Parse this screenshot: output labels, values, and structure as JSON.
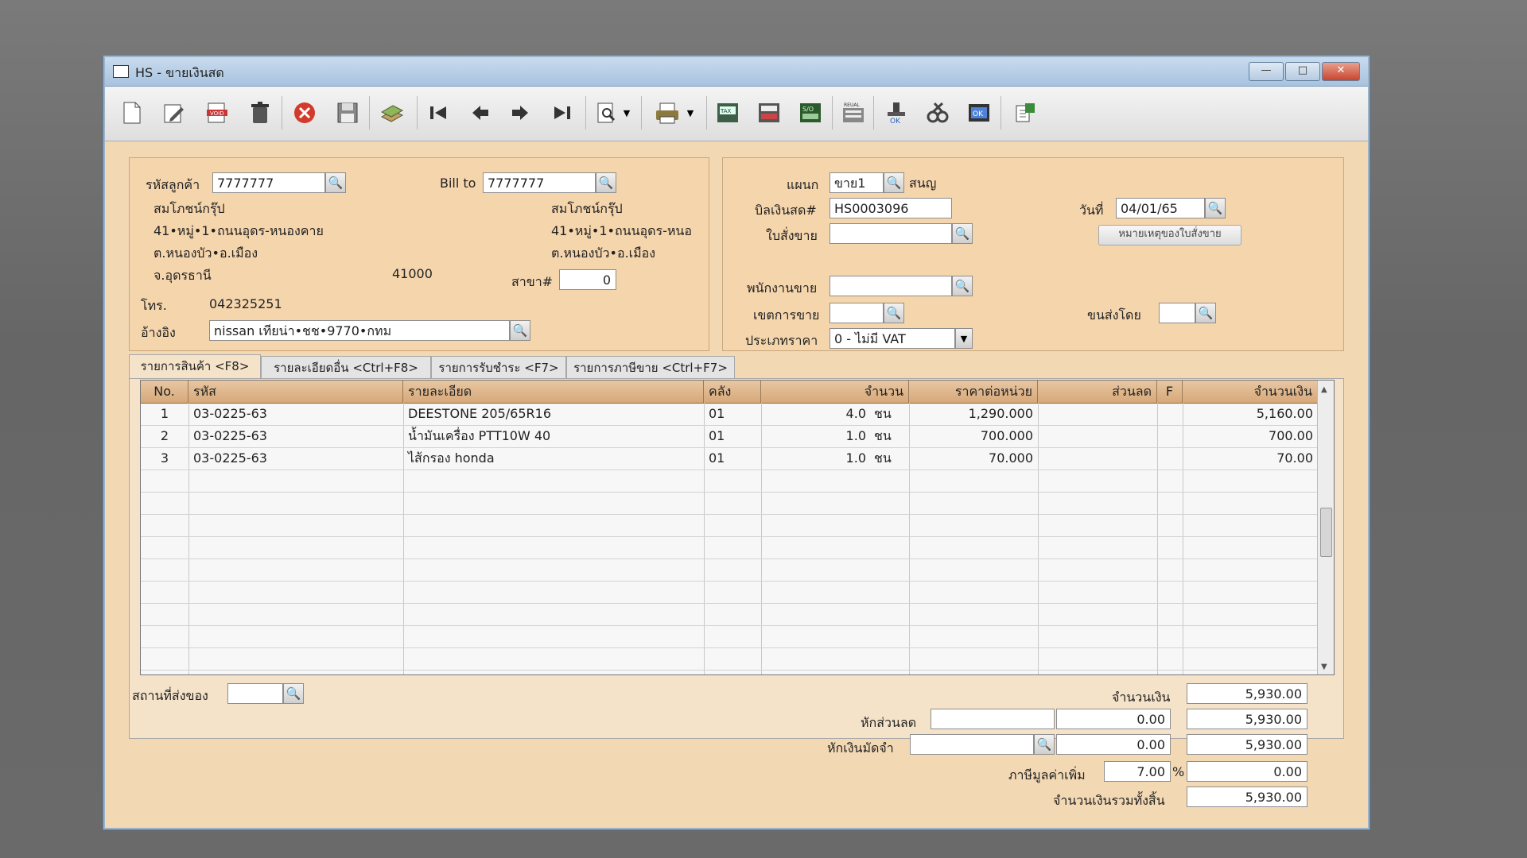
{
  "window": {
    "title": "HS - ขายเงินสด",
    "minimize": "—",
    "maximize": "□",
    "close": "✕"
  },
  "toolbar": {
    "icons": [
      "new-doc-icon",
      "edit-icon",
      "void-icon",
      "delete-icon",
      "cancel-icon",
      "save-icon",
      "stack-icon",
      "first-icon",
      "prev-icon",
      "next-icon",
      "last-icon",
      "search-doc-icon",
      "print-icon",
      "tax-invoice-icon",
      "form-icon",
      "so-icon",
      "report-icon",
      "approve-icon",
      "tools-icon",
      "ok-icon",
      "export-icon"
    ]
  },
  "customer": {
    "code_label": "รหัสลูกค้า",
    "code": "7777777",
    "billto_label": "Bill to",
    "billto": "7777777",
    "name": "สมโภชน์กรุ๊ป",
    "addr1": "41•หมู่•1•ถนนอุดร-หนองคาย",
    "addr2": "ต.หนองบัว•อ.เมือง",
    "province": "จ.อุดรธานี",
    "zip": "41000",
    "billto_name": "สมโภชน์กรุ๊ป",
    "billto_addr1": "41•หมู่•1•ถนนอุดร-หนอ",
    "billto_addr2": "ต.หนองบัว•อ.เมือง",
    "branch_label": "สาขา#",
    "branch": "0",
    "phone_label": "โทร.",
    "phone": "042325251",
    "ref_label": "อ้างอิง",
    "ref": "nissan เทียน่า•ชช•9770•กทม"
  },
  "doc": {
    "dept_label": "แผนก",
    "dept": "ขาย1",
    "dept_name": "สนญ",
    "bill_label": "บิลเงินสด#",
    "bill": "HS0003096",
    "date_label": "วันที่",
    "date": "04/01/65",
    "so_label": "ใบสั่งขาย",
    "so": "",
    "note_button": "หมายเหตุของใบสั่งขาย",
    "sales_label": "พนักงานขาย",
    "sales": "",
    "area_label": "เขตการขาย",
    "area": "",
    "ship_label": "ขนส่งโดย",
    "ship": "",
    "price_type_label": "ประเภทราคา",
    "price_type": "0 - ไม่มี VAT"
  },
  "tabs": [
    "รายการสินค้า <F8>",
    "รายละเอียดอื่น <Ctrl+F8>",
    "รายการรับชำระ <F7>",
    "รายการภาษีขาย <Ctrl+F7>"
  ],
  "grid": {
    "headers": [
      "No.",
      "รหัส",
      "รายละเอียด",
      "คลัง",
      "จำนวน",
      "ราคาต่อหน่วย",
      "ส่วนลด",
      "F",
      "จำนวนเงิน"
    ],
    "rows": [
      {
        "no": "1",
        "code": "03-0225-63",
        "desc": "DEESTONE 205/65R16",
        "wh": "01",
        "qty": "4.0",
        "unit": "ชน",
        "price": "1,290.000",
        "disc": "",
        "f": "",
        "amount": "5,160.00"
      },
      {
        "no": "2",
        "code": "03-0225-63",
        "desc": "น้ำมันเครื่อง PTT10W 40",
        "wh": "01",
        "qty": "1.0",
        "unit": "ชน",
        "price": "700.000",
        "disc": "",
        "f": "",
        "amount": "700.00"
      },
      {
        "no": "3",
        "code": "03-0225-63",
        "desc": "ไส้กรอง honda",
        "wh": "01",
        "qty": "1.0",
        "unit": "ชน",
        "price": "70.000",
        "disc": "",
        "f": "",
        "amount": "70.00"
      }
    ]
  },
  "footer": {
    "delivery_label": "สถานที่ส่งของ",
    "delivery": "",
    "total_label": "จำนวนเงิน",
    "total": "5,930.00",
    "discount_label": "หักส่วนลด",
    "discount_text": "",
    "discount_amount": "0.00",
    "after_discount": "5,930.00",
    "deposit_label": "หักเงินมัดจำ",
    "deposit_text": "",
    "deposit_amount": "0.00",
    "after_deposit": "5,930.00",
    "vat_label": "ภาษีมูลค่าเพิ่ม",
    "vat_rate": "7.00",
    "vat_percent": "%",
    "vat_amount": "0.00",
    "grand_label": "จำนวนเงินรวมทั้งสิ้น",
    "grand_total": "5,930.00"
  }
}
